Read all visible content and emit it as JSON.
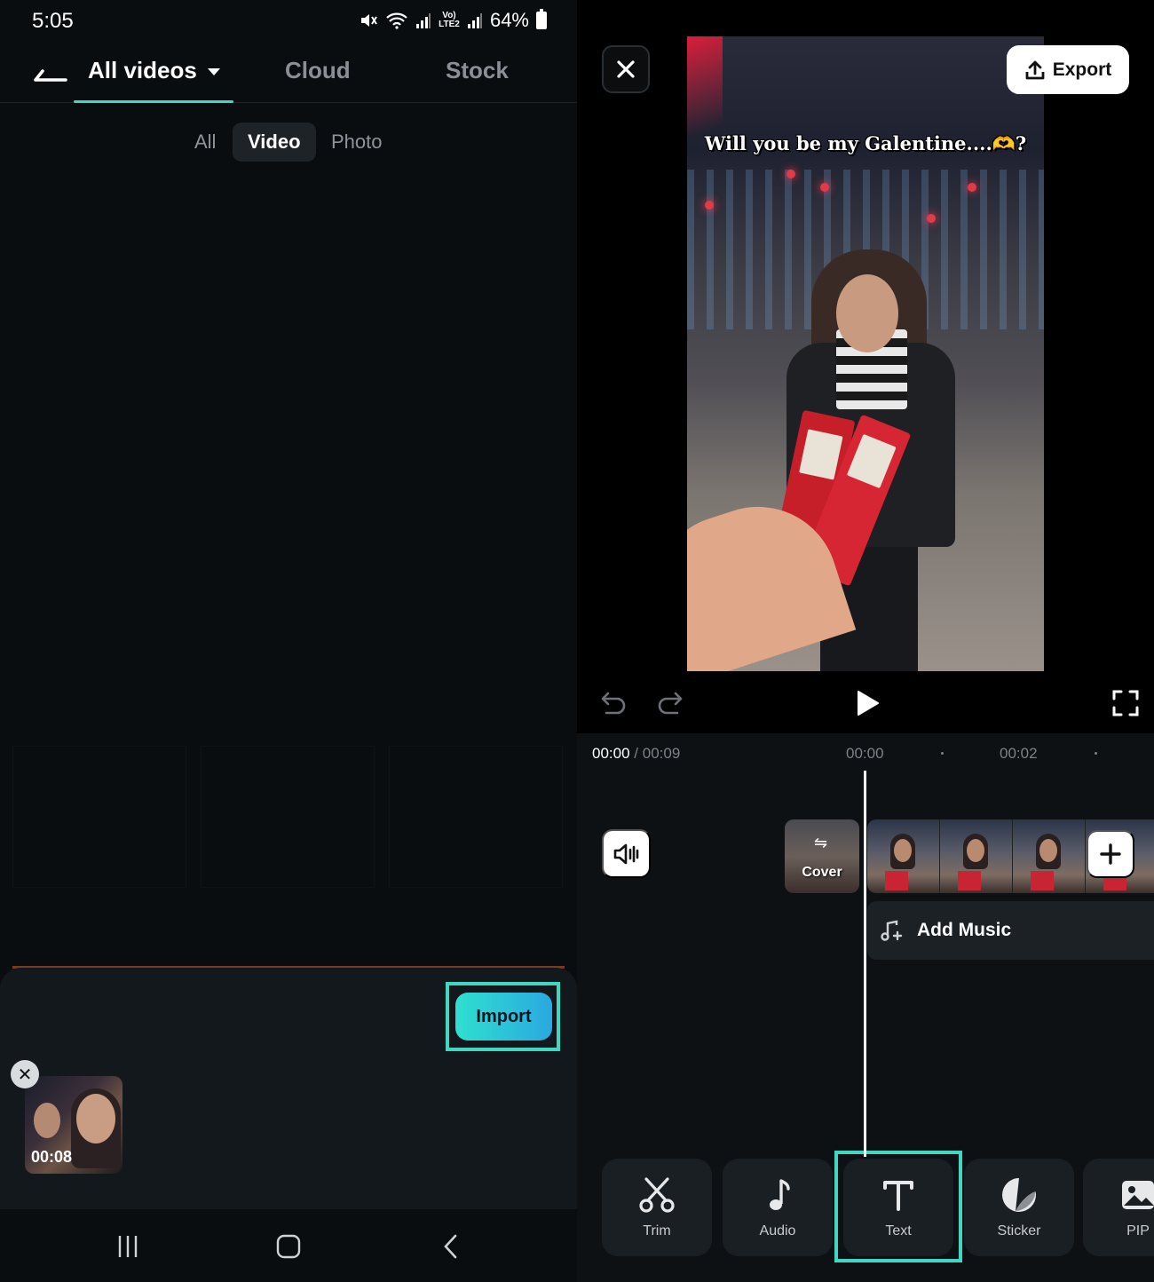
{
  "status_bar": {
    "time": "5:05",
    "battery": "64%",
    "network_label": "Vo) LTE2"
  },
  "library": {
    "tabs": [
      {
        "label": "All videos",
        "active": true
      },
      {
        "label": "Cloud",
        "active": false
      },
      {
        "label": "Stock",
        "active": false
      }
    ],
    "filters": [
      {
        "label": "All",
        "active": false
      },
      {
        "label": "Video",
        "active": true
      },
      {
        "label": "Photo",
        "active": false
      }
    ],
    "import_label": "Import",
    "selected_items": [
      {
        "duration": "00:08"
      }
    ]
  },
  "editor": {
    "export_label": "Export",
    "overlay_text": "Will you be my Galentine....🫶?",
    "time_current": "00:00",
    "time_separator": "/",
    "time_total": "00:09",
    "ruler_labels": [
      "00:00",
      "00:02"
    ],
    "cover_label": "Cover",
    "add_music_label": "Add Music",
    "tools": [
      {
        "label": "Trim",
        "icon": "scissors-icon"
      },
      {
        "label": "Audio",
        "icon": "music-note-icon"
      },
      {
        "label": "Text",
        "icon": "text-icon",
        "highlighted": true
      },
      {
        "label": "Sticker",
        "icon": "sticker-icon"
      },
      {
        "label": "PIP",
        "icon": "pip-icon"
      }
    ]
  },
  "colors": {
    "accent": "#3fd6c2",
    "import_gradient_start": "#2fe0d0",
    "import_gradient_end": "#2aa8e0",
    "background": "#0a0d10"
  }
}
